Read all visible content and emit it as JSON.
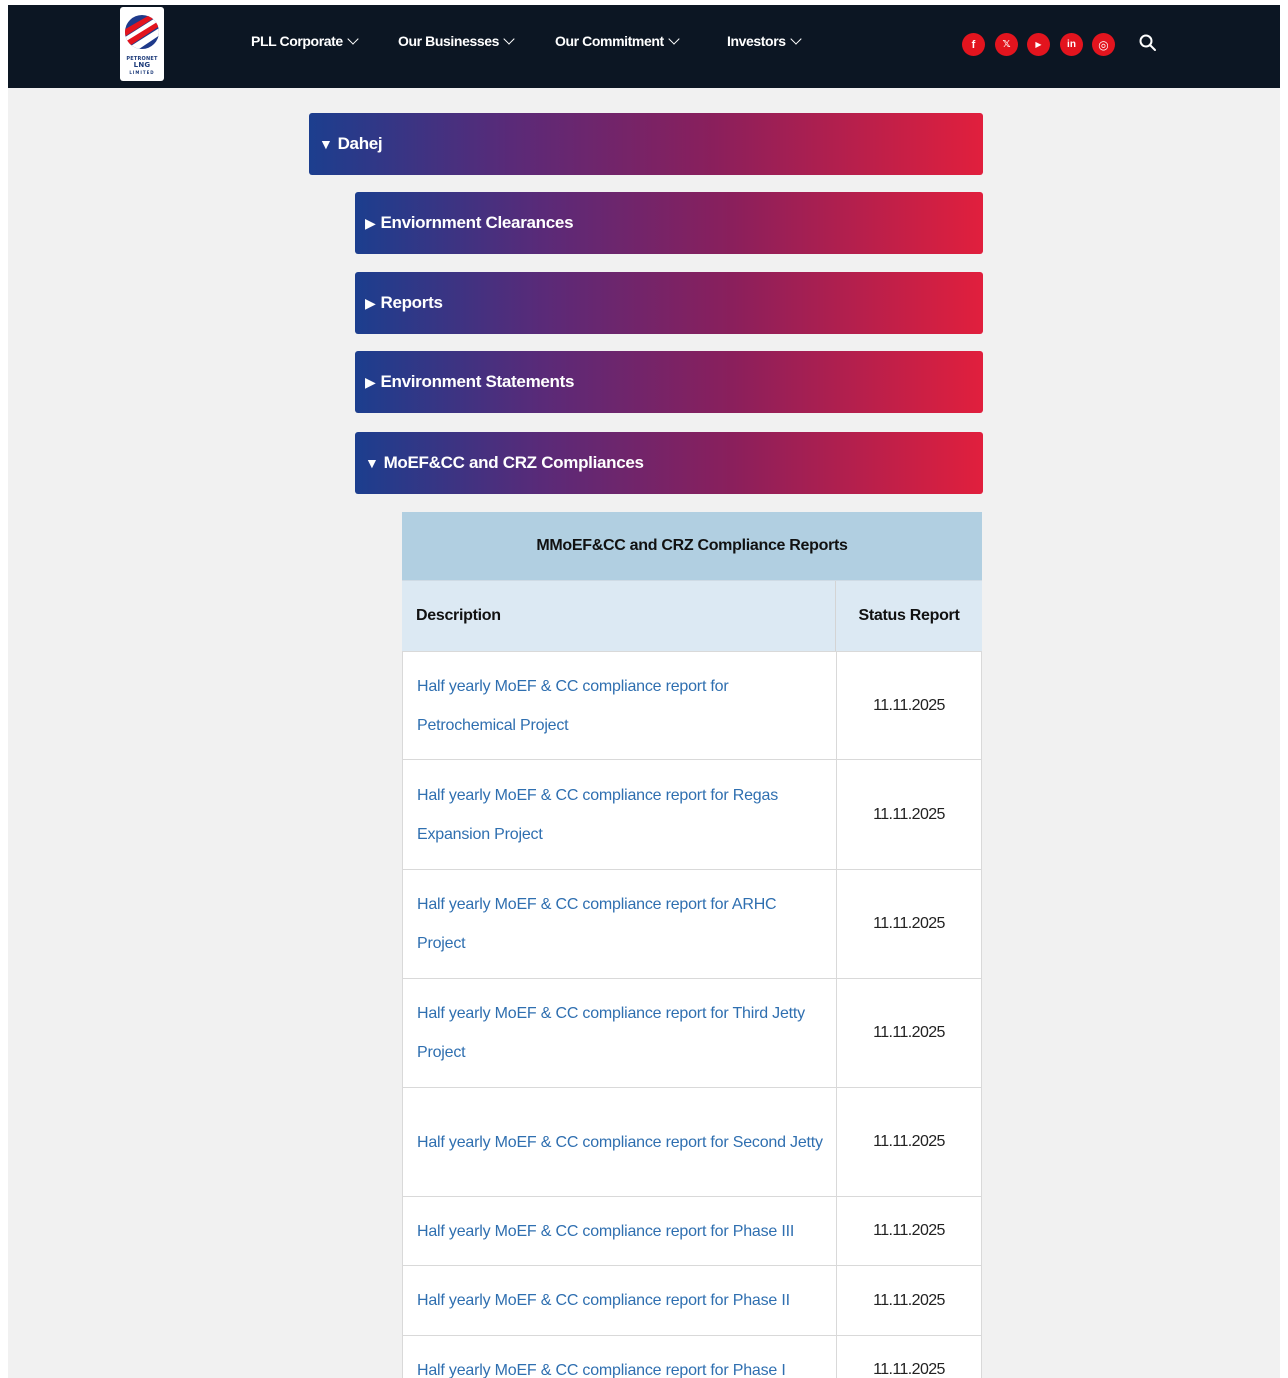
{
  "header": {
    "logo": {
      "line1": "PETRONET",
      "line2": "LNG",
      "line3": "LIMITED"
    },
    "nav": [
      {
        "label": "PLL Corporate"
      },
      {
        "label": "Our Businesses"
      },
      {
        "label": "Our Commitment"
      },
      {
        "label": "Investors"
      }
    ],
    "social": [
      {
        "icon": "facebook-icon",
        "glyph": "f"
      },
      {
        "icon": "x-twitter-icon",
        "glyph": "𝕏"
      },
      {
        "icon": "youtube-icon",
        "glyph": "▶"
      },
      {
        "icon": "linkedin-icon",
        "glyph": "in"
      },
      {
        "icon": "instagram-icon",
        "glyph": "◎"
      }
    ],
    "search_icon": "search-icon"
  },
  "accordion": {
    "root": {
      "label": "Dahej",
      "expanded": true
    },
    "children": [
      {
        "label": "Enviornment Clearances",
        "expanded": false
      },
      {
        "label": "Reports",
        "expanded": false
      },
      {
        "label": "Environment Statements",
        "expanded": false
      },
      {
        "label": "MoEF&CC and CRZ Compliances",
        "expanded": true
      }
    ]
  },
  "table": {
    "caption": "MMoEF&CC and CRZ Compliance Reports",
    "headers": {
      "description": "Description",
      "status": "Status Report"
    },
    "rows": [
      {
        "description": "Half yearly MoEF & CC compliance report for Petrochemical Project",
        "status": "11.11.2025"
      },
      {
        "description": "Half yearly MoEF & CC compliance report for Regas Expansion Project",
        "status": "11.11.2025"
      },
      {
        "description": "Half yearly MoEF & CC compliance report for ARHC Project",
        "status": "11.11.2025"
      },
      {
        "description": "Half yearly MoEF & CC compliance report for Third Jetty Project",
        "status": "11.11.2025"
      },
      {
        "description": "Half yearly MoEF & CC compliance report for Second Jetty",
        "status": "11.11.2025"
      },
      {
        "description": "Half yearly MoEF & CC compliance report for Phase III",
        "status": "11.11.2025"
      },
      {
        "description": "Half yearly MoEF & CC compliance report for Phase II",
        "status": "11.11.2025"
      },
      {
        "description": "Half yearly MoEF & CC compliance report for Phase I",
        "status": "11.11.2025"
      }
    ]
  },
  "colors": {
    "header_bg": "#0c1623",
    "accent_red": "#e3141e",
    "gradient_start": "#1c3e8e",
    "gradient_end": "#e11f3d",
    "link": "#2f6fb0",
    "table_caption_bg": "#b1cfe1",
    "table_head_bg": "#dce9f3"
  }
}
